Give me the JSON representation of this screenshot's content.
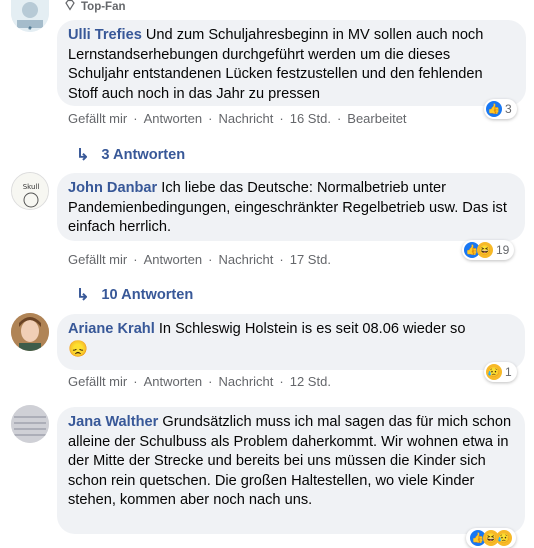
{
  "comments": [
    {
      "badge": "Top-Fan",
      "author": "Ulli Trefies",
      "text": "Und zum Schuljahresbeginn in MV sollen auch noch Lernstandserhebungen durchgeführt werden um die dieses Schuljahr entstandenen Lücken festzustellen und den fehlenden Stoff auch noch in das Jahr zu pressen",
      "actions": {
        "like": "Gefällt mir",
        "reply": "Antworten",
        "message": "Nachricht",
        "time": "16 Std.",
        "edited": "Bearbeitet"
      },
      "reaction_count": "3",
      "replies": "3 Antworten"
    },
    {
      "author": "John Danbar",
      "text": "Ich liebe das Deutsche: Normalbetrieb unter Pandemienbedingungen, eingeschränkter Regelbetrieb usw. Das ist einfach herrlich.",
      "actions": {
        "like": "Gefällt mir",
        "reply": "Antworten",
        "message": "Nachricht",
        "time": "17 Std."
      },
      "reaction_count": "19",
      "replies": "10 Antworten"
    },
    {
      "author": "Ariane Krahl",
      "text": "In Schleswig Holstein is es seit 08.06 wieder so",
      "emoji": "😞",
      "actions": {
        "like": "Gefällt mir",
        "reply": "Antworten",
        "message": "Nachricht",
        "time": "12 Std."
      },
      "reaction_count": "1"
    },
    {
      "author": "Jana Walther",
      "text": "Grundsätzlich muss ich mal sagen das für mich schon alleine der Schulbuss als Problem daherkommt. Wir wohnen etwa in der Mitte der Strecke und bereits bei uns müssen die Kinder sich schon rein quetschen. Die großen Haltestellen, wo viele Kinder stehen, kommen aber noch nach uns."
    }
  ],
  "colors": {
    "author": "#385898",
    "bubble": "#f0f2f5",
    "meta": "#65676b",
    "like": "#1877f2"
  }
}
